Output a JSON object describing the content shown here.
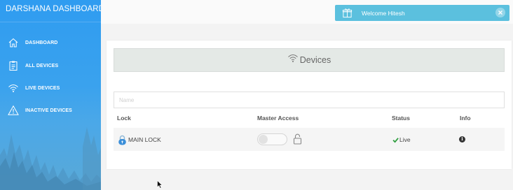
{
  "sidebar": {
    "brand": "DARSHANA DASHBOARD",
    "items": [
      {
        "label": "DASHBOARD",
        "icon": "home-icon"
      },
      {
        "label": "ALL DEVICES",
        "icon": "clipboard-icon"
      },
      {
        "label": "LIVE DEVICES",
        "icon": "wifi-icon"
      },
      {
        "label": "INACTIVE DEVICES",
        "icon": "warning-icon"
      }
    ]
  },
  "notification": {
    "message": "Welcome Hitesh",
    "icon": "gift-icon",
    "color": "#5bc0de"
  },
  "devices": {
    "title": "Devices",
    "icon": "wifi-icon",
    "filter_placeholder": "Name",
    "filter_value": "",
    "columns": {
      "lock": "Lock",
      "master_access": "Master Access",
      "status": "Status",
      "info": "Info"
    },
    "rows": [
      {
        "lock_name": "MAIN LOCK",
        "master_access_on": false,
        "status": "Live",
        "status_color": "#2e9e3e"
      }
    ]
  },
  "colors": {
    "sidebar_blue": "#2f9cf0",
    "header_gray": "#e4e9e6"
  }
}
